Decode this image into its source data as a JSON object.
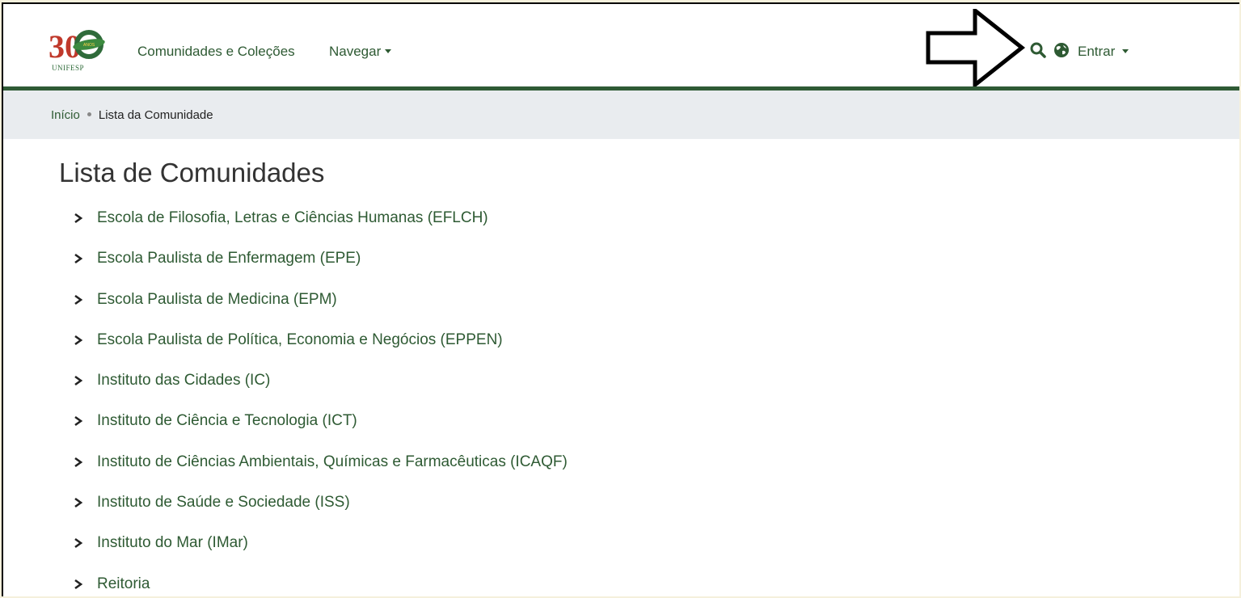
{
  "header": {
    "logo": {
      "number": "30",
      "badge": "ANOS",
      "text": "UNIFESP"
    },
    "nav": {
      "communities_label": "Comunidades e Coleções",
      "browse_label": "Navegar"
    },
    "login_label": "Entrar",
    "icons": [
      "search-icon",
      "globe-icon",
      "annotation-arrow-icon"
    ]
  },
  "breadcrumb": {
    "home": "Início",
    "current": "Lista da Comunidade"
  },
  "main": {
    "title": "Lista de Comunidades",
    "communities": [
      "Escola de Filosofia, Letras e Ciências Humanas (EFLCH)",
      "Escola Paulista de Enfermagem (EPE)",
      "Escola Paulista de Medicina (EPM)",
      "Escola Paulista de Política, Economia e Negócios (EPPEN)",
      "Instituto das Cidades (IC)",
      "Instituto de Ciência e Tecnologia (ICT)",
      "Instituto de Ciências Ambientais, Químicas e Farmacêuticas (ICAQF)",
      "Instituto de Saúde e Sociedade (ISS)",
      "Instituto do Mar (IMar)",
      "Reitoria"
    ]
  },
  "colors": {
    "brand_green": "#2f5a35",
    "link_green": "#2e5a33",
    "breadcrumb_bg": "#e9ecef",
    "outer_bg": "#f5f0dc"
  }
}
